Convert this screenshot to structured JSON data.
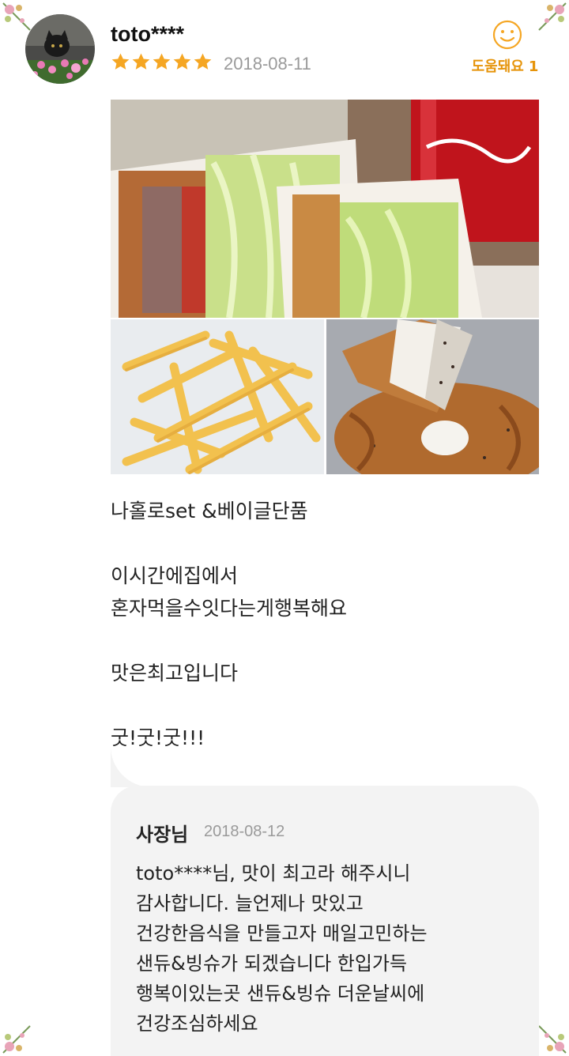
{
  "review": {
    "username": "toto****",
    "rating": 5,
    "date": "2018-08-11",
    "helpful_label": "도움돼요",
    "helpful_count": "1",
    "photos": [
      "burger-photo",
      "fries-photo",
      "bagel-photo"
    ],
    "lines": [
      "나홀로set &베이글단품",
      "",
      "이시간에집에서",
      "혼자먹을수잇다는게행복해요",
      "",
      "맛은최고입니다",
      "",
      "굿!굿!굿!!!"
    ]
  },
  "owner_reply": {
    "name": "사장님",
    "date": "2018-08-12",
    "lines": [
      "toto****님, 맛이 최고라 해주시니",
      "감사합니다. 늘언제나 맛있고",
      "건강한음식을 만들고자 매일고민하는",
      "샌듀&빙슈가 되겠습니다 한입가득",
      "행복이있는곳 샌듀&빙슈 더운날씨에",
      "건강조심하세요"
    ]
  },
  "colors": {
    "star": "#f5a623",
    "helpful": "#e6940a",
    "date": "#9a9a9a",
    "reply_bg": "#f3f3f3"
  }
}
